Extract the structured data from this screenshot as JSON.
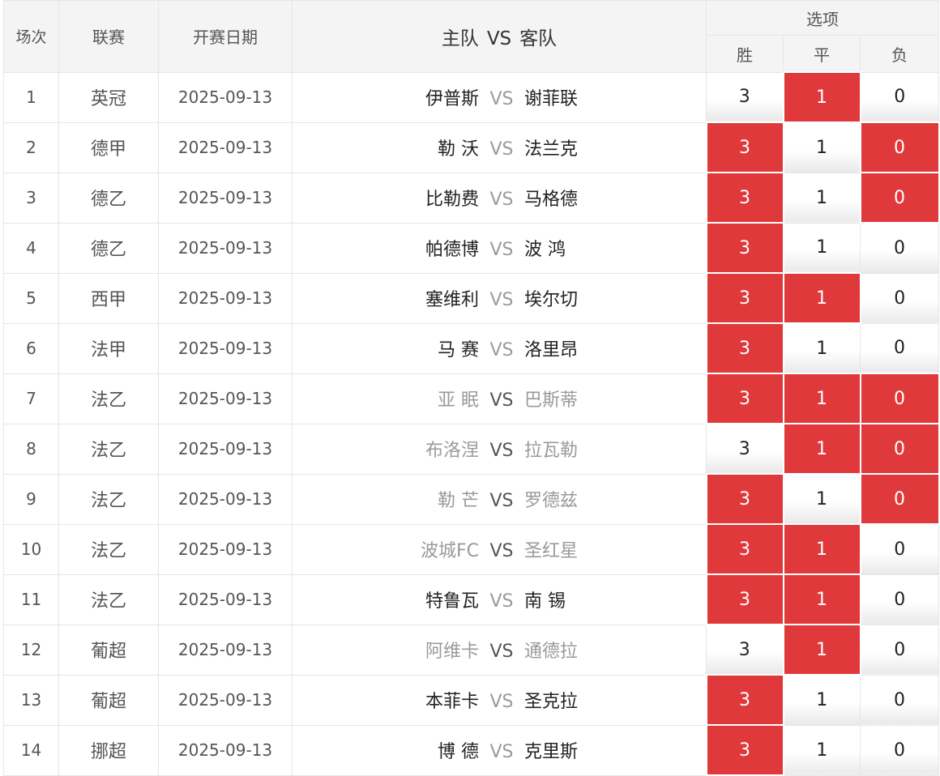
{
  "header": {
    "no": "场次",
    "league": "联赛",
    "date": "开赛日期",
    "home": "主队",
    "vs": "VS",
    "away": "客队",
    "options": "选项",
    "win": "胜",
    "draw": "平",
    "lose": "负"
  },
  "colors": {
    "selected": "#e0393c",
    "muted": "#9a9a9a"
  },
  "rows": [
    {
      "no": "1",
      "league": "英冠",
      "date": "2025-09-13",
      "home": "伊普斯",
      "vs": "VS",
      "away": "谢菲联",
      "dim": false,
      "win": "3",
      "draw": "1",
      "lose": "0",
      "sel": [
        false,
        true,
        false
      ]
    },
    {
      "no": "2",
      "league": "德甲",
      "date": "2025-09-13",
      "home": "勒 沃",
      "vs": "VS",
      "away": "法兰克",
      "dim": false,
      "win": "3",
      "draw": "1",
      "lose": "0",
      "sel": [
        true,
        false,
        true
      ]
    },
    {
      "no": "3",
      "league": "德乙",
      "date": "2025-09-13",
      "home": "比勒费",
      "vs": "VS",
      "away": "马格德",
      "dim": false,
      "win": "3",
      "draw": "1",
      "lose": "0",
      "sel": [
        true,
        false,
        true
      ]
    },
    {
      "no": "4",
      "league": "德乙",
      "date": "2025-09-13",
      "home": "帕德博",
      "vs": "VS",
      "away": "波 鸿",
      "dim": false,
      "win": "3",
      "draw": "1",
      "lose": "0",
      "sel": [
        true,
        false,
        false
      ]
    },
    {
      "no": "5",
      "league": "西甲",
      "date": "2025-09-13",
      "home": "塞维利",
      "vs": "VS",
      "away": "埃尔切",
      "dim": false,
      "win": "3",
      "draw": "1",
      "lose": "0",
      "sel": [
        true,
        true,
        false
      ]
    },
    {
      "no": "6",
      "league": "法甲",
      "date": "2025-09-13",
      "home": "马 赛",
      "vs": "VS",
      "away": "洛里昂",
      "dim": false,
      "win": "3",
      "draw": "1",
      "lose": "0",
      "sel": [
        true,
        false,
        false
      ]
    },
    {
      "no": "7",
      "league": "法乙",
      "date": "2025-09-13",
      "home": "亚 眠",
      "vs": "VS",
      "away": "巴斯蒂",
      "dim": true,
      "win": "3",
      "draw": "1",
      "lose": "0",
      "sel": [
        true,
        true,
        true
      ]
    },
    {
      "no": "8",
      "league": "法乙",
      "date": "2025-09-13",
      "home": "布洛涅",
      "vs": "VS",
      "away": "拉瓦勒",
      "dim": true,
      "win": "3",
      "draw": "1",
      "lose": "0",
      "sel": [
        false,
        true,
        true
      ]
    },
    {
      "no": "9",
      "league": "法乙",
      "date": "2025-09-13",
      "home": "勒 芒",
      "vs": "VS",
      "away": "罗德兹",
      "dim": true,
      "win": "3",
      "draw": "1",
      "lose": "0",
      "sel": [
        true,
        false,
        true
      ]
    },
    {
      "no": "10",
      "league": "法乙",
      "date": "2025-09-13",
      "home": "波城FC",
      "vs": "VS",
      "away": "圣红星",
      "dim": true,
      "win": "3",
      "draw": "1",
      "lose": "0",
      "sel": [
        true,
        true,
        false
      ]
    },
    {
      "no": "11",
      "league": "法乙",
      "date": "2025-09-13",
      "home": "特鲁瓦",
      "vs": "VS",
      "away": "南 锡",
      "dim": false,
      "win": "3",
      "draw": "1",
      "lose": "0",
      "sel": [
        true,
        true,
        false
      ]
    },
    {
      "no": "12",
      "league": "葡超",
      "date": "2025-09-13",
      "home": "阿维卡",
      "vs": "VS",
      "away": "通德拉",
      "dim": true,
      "win": "3",
      "draw": "1",
      "lose": "0",
      "sel": [
        false,
        true,
        false
      ]
    },
    {
      "no": "13",
      "league": "葡超",
      "date": "2025-09-13",
      "home": "本菲卡",
      "vs": "VS",
      "away": "圣克拉",
      "dim": false,
      "win": "3",
      "draw": "1",
      "lose": "0",
      "sel": [
        true,
        false,
        false
      ]
    },
    {
      "no": "14",
      "league": "挪超",
      "date": "2025-09-13",
      "home": "博 德",
      "vs": "VS",
      "away": "克里斯",
      "dim": false,
      "win": "3",
      "draw": "1",
      "lose": "0",
      "sel": [
        true,
        false,
        false
      ]
    }
  ]
}
